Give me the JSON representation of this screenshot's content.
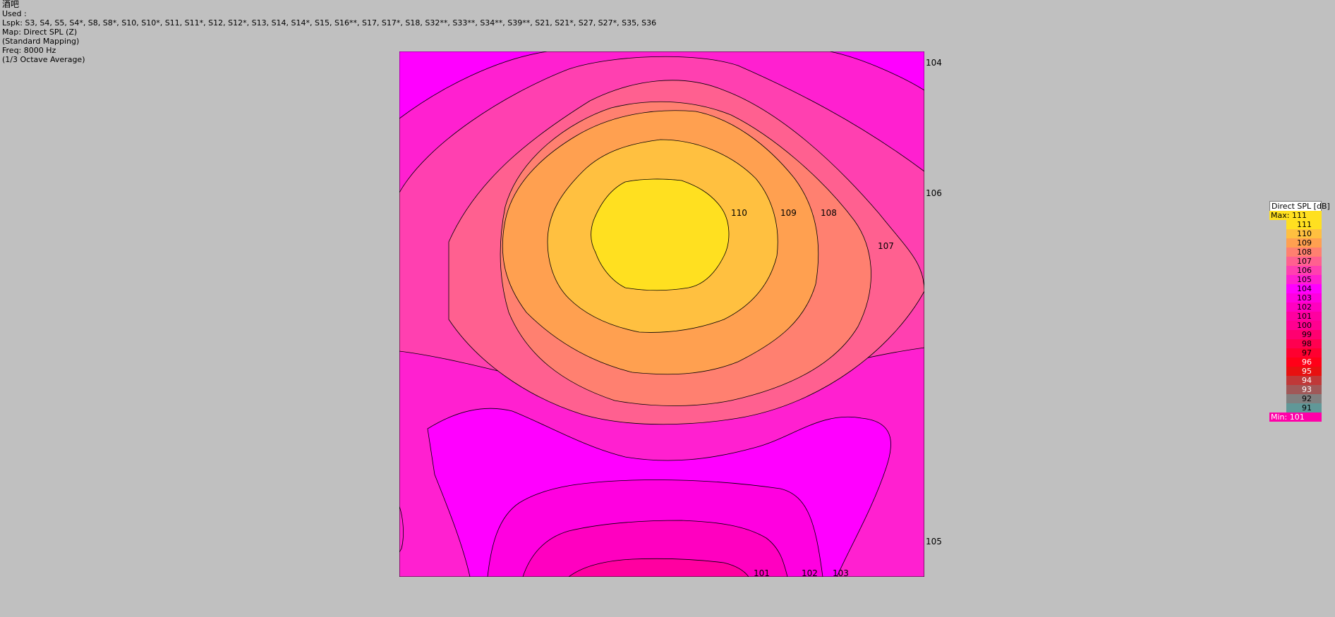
{
  "info": {
    "title": "酒吧",
    "used": "Used :",
    "lspk": "Lspk: S3, S4, S5, S4*, S8, S8*, S10, S10*, S11, S11*, S12, S12*, S13, S14, S14*, S15, S16**, S17, S17*, S18, S32**, S33**, S34**, S39**, S21, S21*, S27, S27*, S35, S36",
    "map": "Map: Direct SPL (Z)",
    "mapping": "(Standard Mapping)",
    "freq": "Freq: 8000 Hz",
    "average": "(1/3 Octave Average)"
  },
  "chart_data": {
    "type": "heatmap",
    "variable": "Direct SPL",
    "unit": "dB",
    "frequency_hz": 8000,
    "max": 111,
    "min": 101,
    "contour_labels": [
      {
        "value": "110"
      },
      {
        "value": "109"
      },
      {
        "value": "108"
      },
      {
        "value": "107"
      },
      {
        "value": "101"
      },
      {
        "value": "102"
      },
      {
        "value": "103"
      }
    ],
    "edge_labels": [
      {
        "value": "104"
      },
      {
        "value": "106"
      },
      {
        "value": "105"
      }
    ],
    "colors": {
      "111": "#ffe020",
      "110": "#ffc040",
      "109": "#ffa050",
      "108": "#ff8070",
      "107": "#ff6090",
      "106": "#ff40b0",
      "105": "#ff20d0",
      "104": "#ff00ff",
      "103": "#ff00e0",
      "102": "#ff00c0",
      "101": "#ff00a0",
      "100": "#ff0090",
      "99": "#ff0070",
      "98": "#ff0050",
      "97": "#ff0030",
      "96": "#ff0018",
      "95": "#e81010",
      "94": "#c03838",
      "93": "#a05858",
      "92": "#808080",
      "91": "#609898"
    }
  },
  "legend": {
    "title": "Direct SPL [dB]",
    "max_label": "Max:",
    "max_value": "111",
    "min_label": "Min:",
    "min_value": "101",
    "levels": [
      "111",
      "110",
      "109",
      "108",
      "107",
      "106",
      "105",
      "104",
      "103",
      "102",
      "101",
      "100",
      "99",
      "98",
      "97",
      "96",
      "95",
      "94",
      "93",
      "92",
      "91"
    ]
  }
}
